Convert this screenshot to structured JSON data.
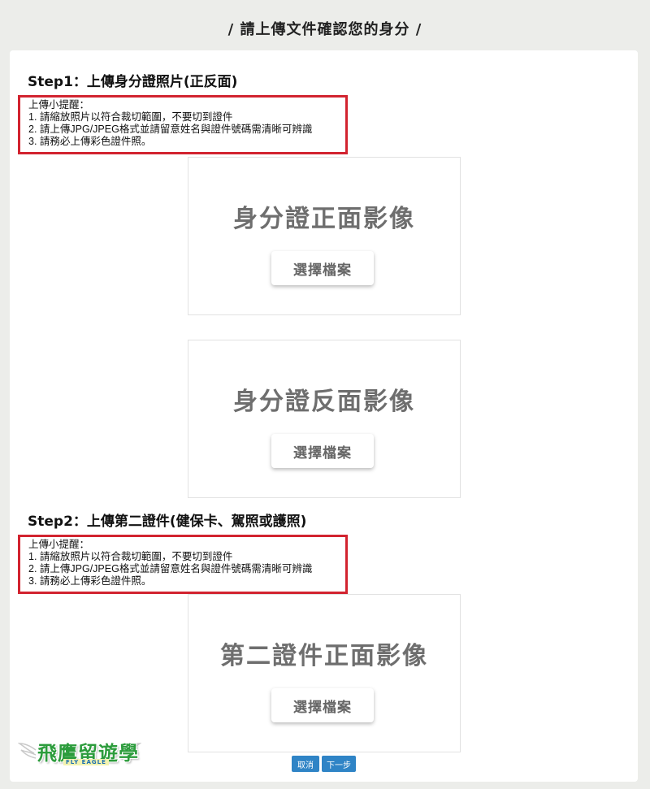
{
  "page": {
    "title": "/ 請上傳文件確認您的身分 /"
  },
  "step1": {
    "title": "Step1：上傳身分證照片(正反面)",
    "tips": [
      "上傳小提醒：",
      "1. 請縮放照片以符合裁切範圍，不要切到證件",
      "2. 請上傳JPG/JPEG格式並請留意姓名與證件號碼需清晰可辨識",
      "3. 請務必上傳彩色證件照。"
    ],
    "front_label": "身分證正面影像",
    "back_label": "身分證反面影像",
    "choose_file": "選擇檔案"
  },
  "step2": {
    "title": "Step2：上傳第二證件(健保卡、駕照或護照)",
    "tips": [
      "上傳小提醒：",
      "1. 請縮放照片以符合裁切範圍，不要切到證件",
      "2. 請上傳JPG/JPEG格式並請留意姓名與證件號碼需清晰可辨識",
      "3. 請務必上傳彩色證件照。"
    ],
    "front_label": "第二證件正面影像",
    "choose_file": "選擇檔案"
  },
  "actions": {
    "cancel": "取消",
    "next": "下一步"
  },
  "logo": {
    "text": "飛鷹留遊學",
    "sub": "FLY EAGLE"
  },
  "colors": {
    "background": "#ecedea",
    "highlight_border": "#d2232f",
    "button_blue": "#2f84c6"
  }
}
